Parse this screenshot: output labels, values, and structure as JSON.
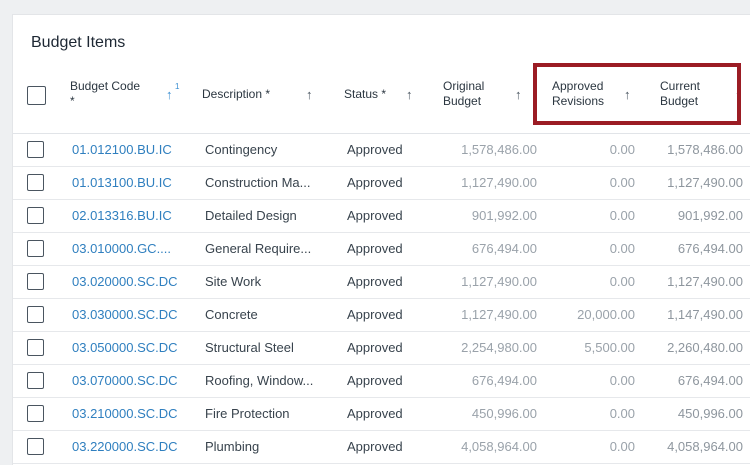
{
  "panel": {
    "title": "Budget Items"
  },
  "columns": {
    "budget_code": {
      "line1": "Budget Code",
      "line2": "*",
      "sort_order": "1"
    },
    "description": {
      "label": "Description *"
    },
    "status": {
      "label": "Status *"
    },
    "original_budget": {
      "line1": "Original",
      "line2": "Budget"
    },
    "approved_revisions": {
      "line1": "Approved",
      "line2": "Revisions"
    },
    "current_budget": {
      "line1": "Current",
      "line2": "Budget"
    }
  },
  "icons": {
    "sort": "arrow-up-icon",
    "checkbox": "checkbox-icon"
  },
  "colors": {
    "link": "#2f7fbf",
    "highlight": "#9b1c24",
    "sort_active": "#3a8ed1"
  },
  "rows": [
    {
      "code": "01.012100.BU.IC",
      "description": "Contingency",
      "status": "Approved",
      "original": "1,578,486.00",
      "revisions": "0.00",
      "current": "1,578,486.00"
    },
    {
      "code": "01.013100.BU.IC",
      "description": "Construction Ma...",
      "status": "Approved",
      "original": "1,127,490.00",
      "revisions": "0.00",
      "current": "1,127,490.00"
    },
    {
      "code": "02.013316.BU.IC",
      "description": "Detailed Design",
      "status": "Approved",
      "original": "901,992.00",
      "revisions": "0.00",
      "current": "901,992.00"
    },
    {
      "code": "03.010000.GC....",
      "description": "General Require...",
      "status": "Approved",
      "original": "676,494.00",
      "revisions": "0.00",
      "current": "676,494.00"
    },
    {
      "code": "03.020000.SC.DC",
      "description": "Site Work",
      "status": "Approved",
      "original": "1,127,490.00",
      "revisions": "0.00",
      "current": "1,127,490.00"
    },
    {
      "code": "03.030000.SC.DC",
      "description": "Concrete",
      "status": "Approved",
      "original": "1,127,490.00",
      "revisions": "20,000.00",
      "current": "1,147,490.00"
    },
    {
      "code": "03.050000.SC.DC",
      "description": "Structural Steel",
      "status": "Approved",
      "original": "2,254,980.00",
      "revisions": "5,500.00",
      "current": "2,260,480.00"
    },
    {
      "code": "03.070000.SC.DC",
      "description": "Roofing, Window...",
      "status": "Approved",
      "original": "676,494.00",
      "revisions": "0.00",
      "current": "676,494.00"
    },
    {
      "code": "03.210000.SC.DC",
      "description": "Fire Protection",
      "status": "Approved",
      "original": "450,996.00",
      "revisions": "0.00",
      "current": "450,996.00"
    },
    {
      "code": "03.220000.SC.DC",
      "description": "Plumbing",
      "status": "Approved",
      "original": "4,058,964.00",
      "revisions": "0.00",
      "current": "4,058,964.00"
    }
  ]
}
